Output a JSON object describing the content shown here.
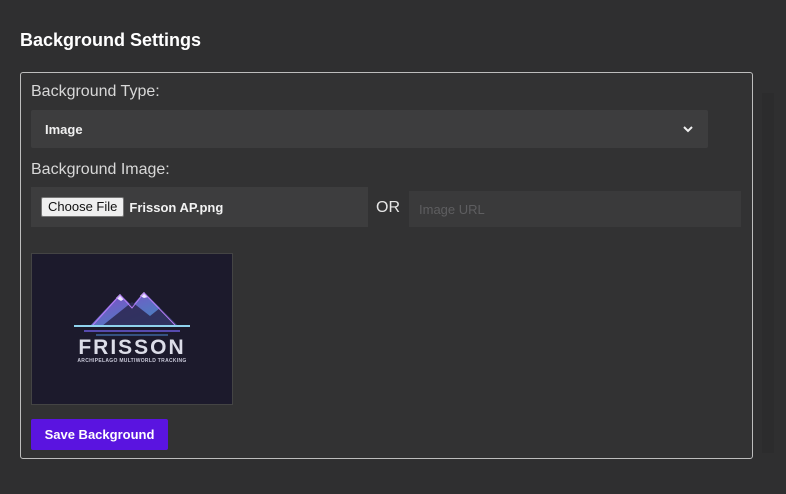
{
  "page": {
    "title": "Background Settings"
  },
  "form": {
    "type_label": "Background Type:",
    "type_select": {
      "selected": "Image",
      "chevron_icon": "chevron-down-icon"
    },
    "image_label": "Background Image:",
    "file_input": {
      "button_label": "Choose File",
      "file_name": "Frisson AP.png"
    },
    "or_label": "OR",
    "url_input": {
      "value": "",
      "placeholder": "Image URL"
    },
    "preview": {
      "logo_title": "FRISSON",
      "logo_subtitle": "ARCHIPELAGO MULTIWORLD TRACKING",
      "colors": {
        "background": "#1c1a2c",
        "mountain_purple": "#8a3fd9",
        "mountain_teal": "#3fb6d9"
      }
    },
    "save_button": {
      "label": "Save Background",
      "color": "#5a14e0"
    }
  }
}
